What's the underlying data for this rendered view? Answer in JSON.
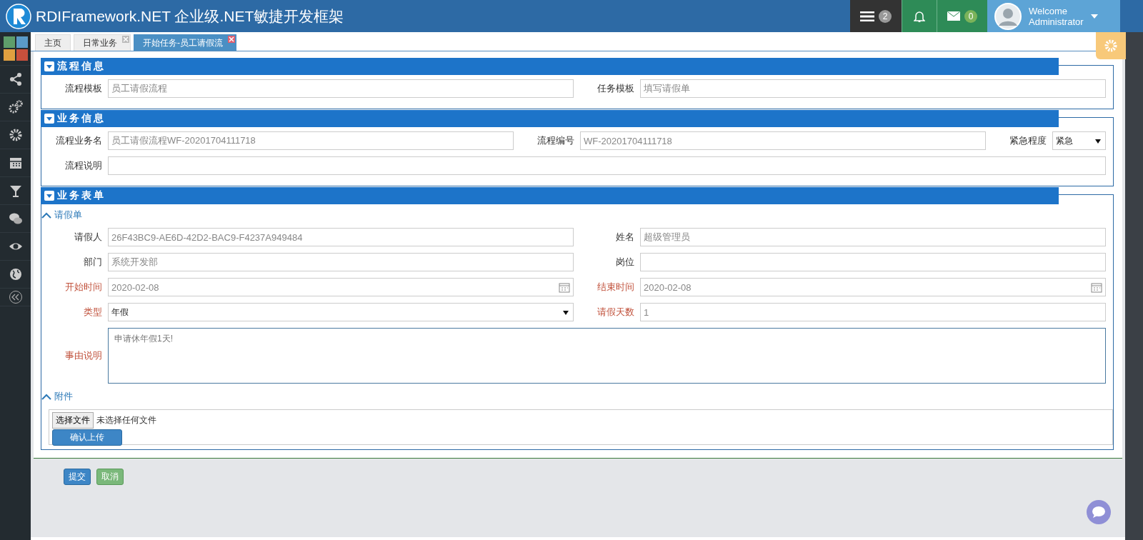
{
  "header": {
    "title": "RDIFramework.NET 企业级.NET敏捷开发框架",
    "tasks_badge": "2",
    "messages_badge": "0",
    "user": {
      "greeting": "Welcome",
      "name": "Administrator"
    }
  },
  "tabs": [
    {
      "label": "主页",
      "selected": false,
      "closable": false
    },
    {
      "label": "日常业务",
      "selected": false,
      "closable": true
    },
    {
      "label": "开始任务-员工请假流",
      "selected": true,
      "closable": true
    }
  ],
  "sections": [
    {
      "title": "流程信息",
      "groups": [
        {
          "rows": [
            [
              {
                "label": "流程模板",
                "kind": "text",
                "value": "员工请假流程",
                "required": false
              },
              {
                "label": "任务模板",
                "kind": "text",
                "value": "填写请假单",
                "required": false
              }
            ]
          ]
        }
      ]
    },
    {
      "title": "业务信息",
      "groups": [
        {
          "rows": [
            [
              {
                "label": "流程业务名",
                "kind": "text",
                "value": "员工请假流程WF-20201704111718",
                "required": false
              },
              {
                "label": "流程编号",
                "kind": "text",
                "value": "WF-20201704111718",
                "required": false
              },
              {
                "label": "紧急程度",
                "kind": "select",
                "value": "紧急",
                "required": false
              }
            ],
            [
              {
                "label": "流程说明",
                "kind": "text",
                "required": false
              }
            ]
          ]
        }
      ]
    },
    {
      "title": "业务表单",
      "groups": [
        {
          "subtitle": "请假单",
          "rows": [
            [
              {
                "label": "请假人",
                "kind": "text",
                "value": "26F43BC9-AE6D-42D2-BAC9-F4237A949484",
                "required": false
              },
              {
                "label": "姓名",
                "kind": "text",
                "value": "超级管理员",
                "required": false
              }
            ],
            [
              {
                "label": "部门",
                "kind": "text",
                "value": "系统开发部",
                "required": false
              },
              {
                "label": "岗位",
                "kind": "text",
                "required": false
              }
            ],
            [
              {
                "label": "开始时间",
                "kind": "date",
                "value": "2020-02-08",
                "required": true
              },
              {
                "label": "结束时间",
                "kind": "date",
                "value": "2020-02-08",
                "required": true
              }
            ],
            [
              {
                "label": "类型",
                "kind": "select",
                "value": "年假",
                "required": true
              },
              {
                "label": "请假天数",
                "kind": "text",
                "value": "1",
                "required": true
              }
            ],
            [
              {
                "label": "事由说明",
                "kind": "textarea",
                "value": "申请休年假1天!",
                "required": true
              }
            ]
          ]
        },
        {
          "subtitle": "附件",
          "upload": {
            "choose_button": "选择文件",
            "status": "未选择任何文件",
            "upload_button": "确认上传"
          }
        }
      ]
    }
  ],
  "actions": [
    {
      "label": "提交",
      "kind": "primary"
    },
    {
      "label": "取消",
      "kind": "secondary"
    }
  ]
}
